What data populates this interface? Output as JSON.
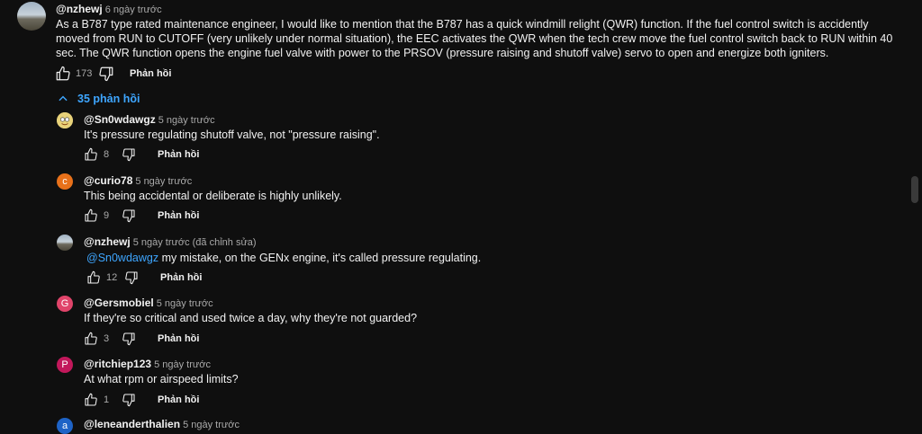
{
  "top": {
    "author": "@nzhewj",
    "time": "6 ngày trước",
    "text": "As a B787 type rated maintenance engineer, I would like to mention that the B787 has a quick windmill relight (QWR) function. If the fuel control switch is accidently moved from RUN to CUTOFF    (very unlikely under normal situation), the EEC activates the QWR when the tech crew move the fuel control switch back to RUN within 40 sec. The QWR function opens the engine fuel valve with power to the PRSOV    (pressure raising and shutoff valve)    servo to open and energize both igniters.",
    "likes": "173",
    "reply_label": "Phản hồi"
  },
  "replies_toggle": "35 phản hồi",
  "replies": [
    {
      "avatar_letter": "",
      "avatar_color": "#e8d27a",
      "author": "@Sn0wdawgz",
      "time": "5 ngày trước",
      "mention": "",
      "text": "It's pressure regulating shutoff valve, not \"pressure raising\".",
      "likes": "8",
      "reply_label": "Phản hồi"
    },
    {
      "avatar_letter": "c",
      "avatar_color": "#e8711a",
      "author": "@curio78",
      "time": "5 ngày trước",
      "mention": "",
      "text": "This being accidental or deliberate is highly unlikely.",
      "likes": "9",
      "reply_label": "Phản hồi"
    },
    {
      "avatar_letter": "",
      "avatar_color": "#8a9aa8",
      "author": "@nzhewj",
      "time": "5 ngày trước (đã chỉnh sửa)",
      "mention": "@Sn0wdawgz",
      "text": "my mistake, on the GENx engine, it's called pressure regulating.",
      "likes": "12",
      "reply_label": "Phản hồi"
    },
    {
      "avatar_letter": "G",
      "avatar_color": "#e0446a",
      "author": "@Gersmobiel",
      "time": "5 ngày trước",
      "mention": "",
      "text": "If they're so critical and used twice a day, why they're not guarded?",
      "likes": "3",
      "reply_label": "Phản hồi"
    },
    {
      "avatar_letter": "P",
      "avatar_color": "#c2185b",
      "author": "@ritchiep123",
      "time": "5 ngày trước",
      "mention": "",
      "text": "At what rpm or airspeed limits?",
      "likes": "1",
      "reply_label": "Phản hồi"
    },
    {
      "avatar_letter": "a",
      "avatar_color": "#1e63c6",
      "author": "@leneanderthalien",
      "time": "5 ngày trước",
      "mention": "",
      "text": "",
      "likes": "",
      "reply_label": ""
    }
  ],
  "colors": {
    "background": "#0f0f0f",
    "link": "#3ea6ff",
    "muted": "#aaaaaa"
  }
}
